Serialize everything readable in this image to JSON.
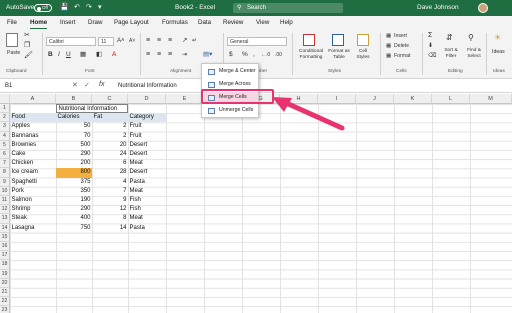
{
  "titlebar": {
    "autosave_label": "AutoSave",
    "autosave_state": "Off",
    "doc_title": "Book2 - Excel",
    "search_placeholder": "Search",
    "user_name": "Dave Johnson"
  },
  "tabs": [
    "File",
    "Home",
    "Insert",
    "Draw",
    "Page Layout",
    "Formulas",
    "Data",
    "Review",
    "View",
    "Help"
  ],
  "active_tab": "Home",
  "ribbon": {
    "clipboard_label": "Clipboard",
    "paste_label": "Paste",
    "font_name": "Calibri",
    "font_size": "11",
    "font_label": "Font",
    "alignment_label": "Alignment",
    "number_format": "General",
    "number_label": "Number",
    "conditional_formatting": "Conditional Formatting",
    "format_as_table": "Format as Table",
    "cell_styles": "Cell Styles",
    "styles_label": "Styles",
    "insert": "Insert",
    "delete": "Delete",
    "format": "Format",
    "cells_label": "Cells",
    "sort_filter": "Sort & Filter",
    "find_select": "Find & Select",
    "editing_label": "Editing",
    "ideas": "Ideas",
    "ideas_group": "Ideas"
  },
  "formula_bar": {
    "name_box": "B1",
    "formula": "Nutritional Information"
  },
  "merge_menu": {
    "items": [
      "Merge & Center",
      "Merge Across",
      "Merge Cells",
      "Unmerge Cells"
    ],
    "highlighted_index": 2
  },
  "columns": [
    "A",
    "B",
    "C",
    "D",
    "E",
    "F",
    "G",
    "H",
    "I",
    "J",
    "K",
    "L",
    "M"
  ],
  "rows": [
    "1",
    "2",
    "3",
    "4",
    "5",
    "6",
    "7",
    "8",
    "9",
    "10",
    "11",
    "12",
    "13",
    "14",
    "15",
    "16",
    "17",
    "18",
    "19",
    "20",
    "21",
    "22",
    "23"
  ],
  "sheet": {
    "merged_header": "Nutritional Information",
    "headers": [
      "Food",
      "Calories",
      "Fat",
      "Category"
    ],
    "data": [
      [
        "Apples",
        "50",
        "2",
        "Fruit"
      ],
      [
        "Bannanas",
        "70",
        "2",
        "Fruit"
      ],
      [
        "Brownies",
        "500",
        "20",
        "Desert"
      ],
      [
        "Cake",
        "290",
        "24",
        "Desert"
      ],
      [
        "Chicken",
        "200",
        "6",
        "Meat"
      ],
      [
        "Ice cream",
        "800",
        "28",
        "Desert"
      ],
      [
        "Spaghetti",
        "375",
        "4",
        "Pasta"
      ],
      [
        "Pork",
        "350",
        "7",
        "Meat"
      ],
      [
        "Salmon",
        "190",
        "9",
        "Fish"
      ],
      [
        "Shrimp",
        "290",
        "12",
        "Fish"
      ],
      [
        "Steak",
        "400",
        "8",
        "Meat"
      ],
      [
        "Lasagna",
        "750",
        "14",
        "Pasta"
      ]
    ]
  },
  "colors": {
    "brand_green": "#1e6e41",
    "header_fill": "#dce6f1",
    "highlight_cell": "#f4b03f",
    "callout_pink": "#e8336e"
  }
}
